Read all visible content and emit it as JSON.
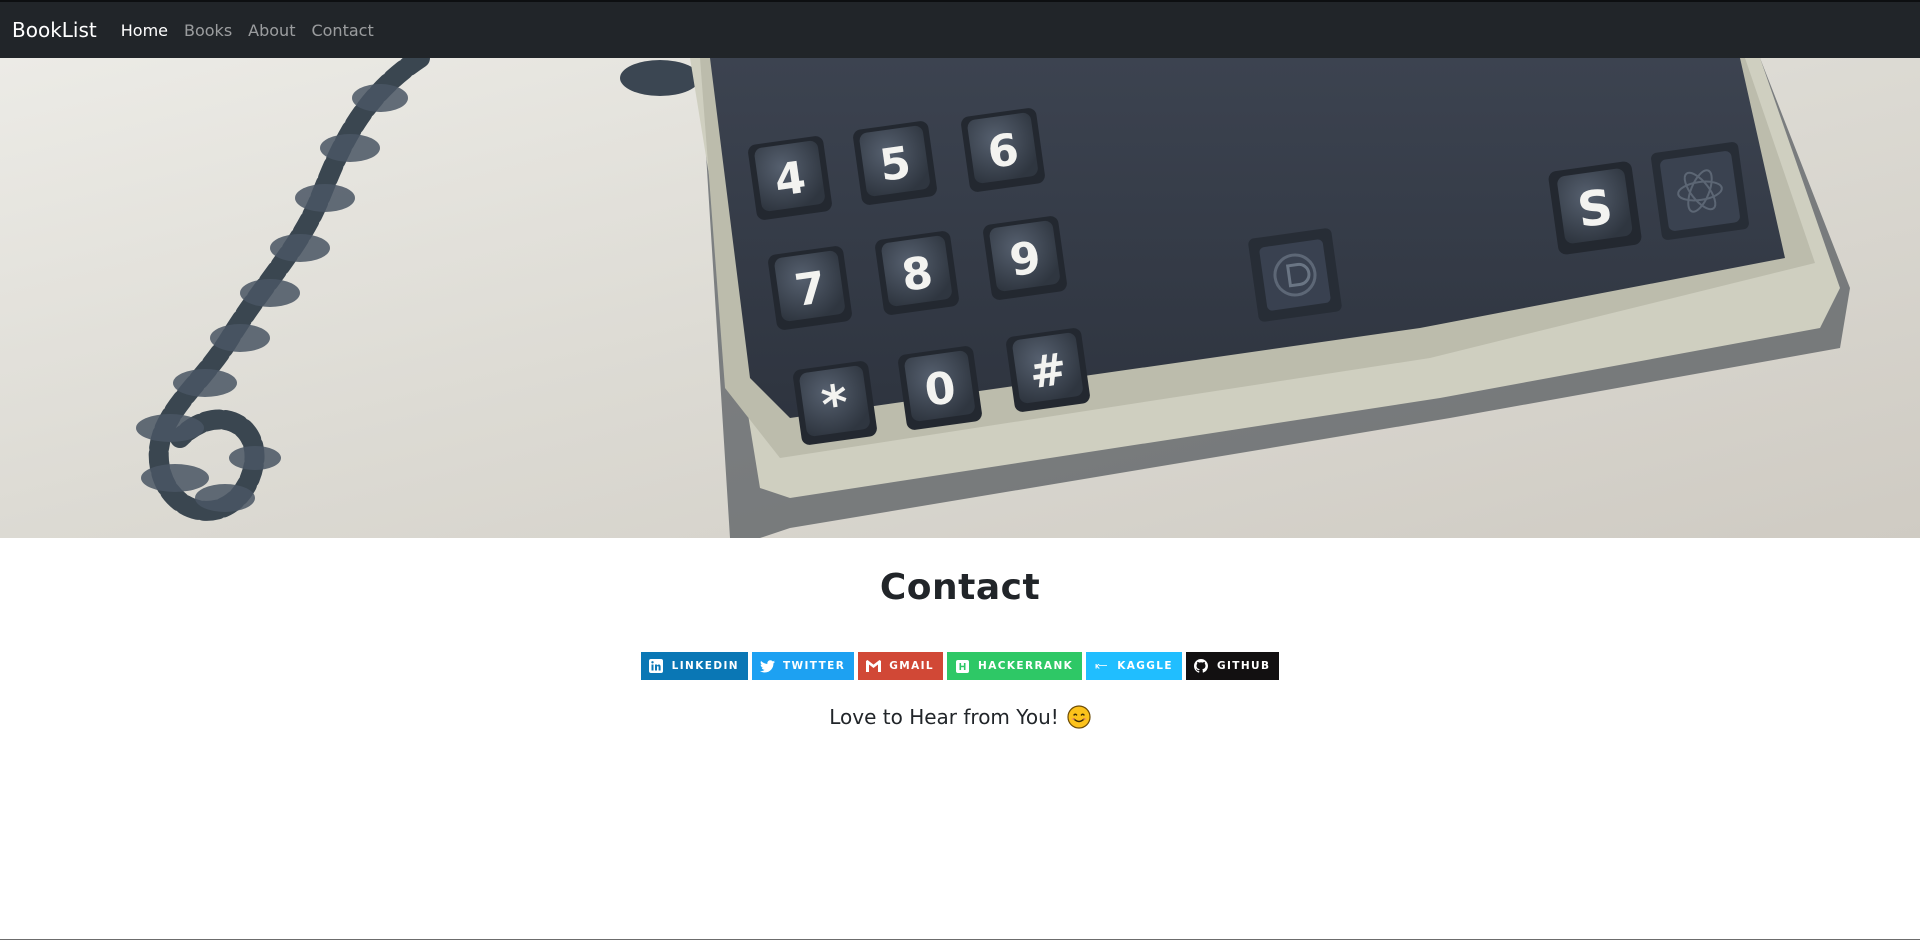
{
  "navbar": {
    "brand": "BookList",
    "links": [
      {
        "label": "Home",
        "active": true
      },
      {
        "label": "Books",
        "active": false
      },
      {
        "label": "About",
        "active": false
      },
      {
        "label": "Contact",
        "active": false
      }
    ]
  },
  "hero": {
    "keys": [
      "4",
      "5",
      "6",
      "7",
      "8",
      "9",
      "*",
      "0",
      "#",
      "S"
    ]
  },
  "main": {
    "title": "Contact",
    "badges": [
      {
        "label": "LINKEDIN",
        "color": "#0a77b5",
        "icon": "linkedin-icon"
      },
      {
        "label": "TWITTER",
        "color": "#1da1f2",
        "icon": "twitter-icon"
      },
      {
        "label": "GMAIL",
        "color": "#d14836",
        "icon": "gmail-icon"
      },
      {
        "label": "HACKERRANK",
        "color": "#2ec866",
        "icon": "hackerrank-icon"
      },
      {
        "label": "KAGGLE",
        "color": "#20beff",
        "icon": "kaggle-icon"
      },
      {
        "label": "GITHUB",
        "color": "#121011",
        "icon": "github-icon"
      }
    ],
    "tagline": "Love to Hear from You!",
    "tagline_emoji": "smiling-face-icon"
  },
  "colors": {
    "navbar_bg": "#212529",
    "text": "#212529"
  }
}
